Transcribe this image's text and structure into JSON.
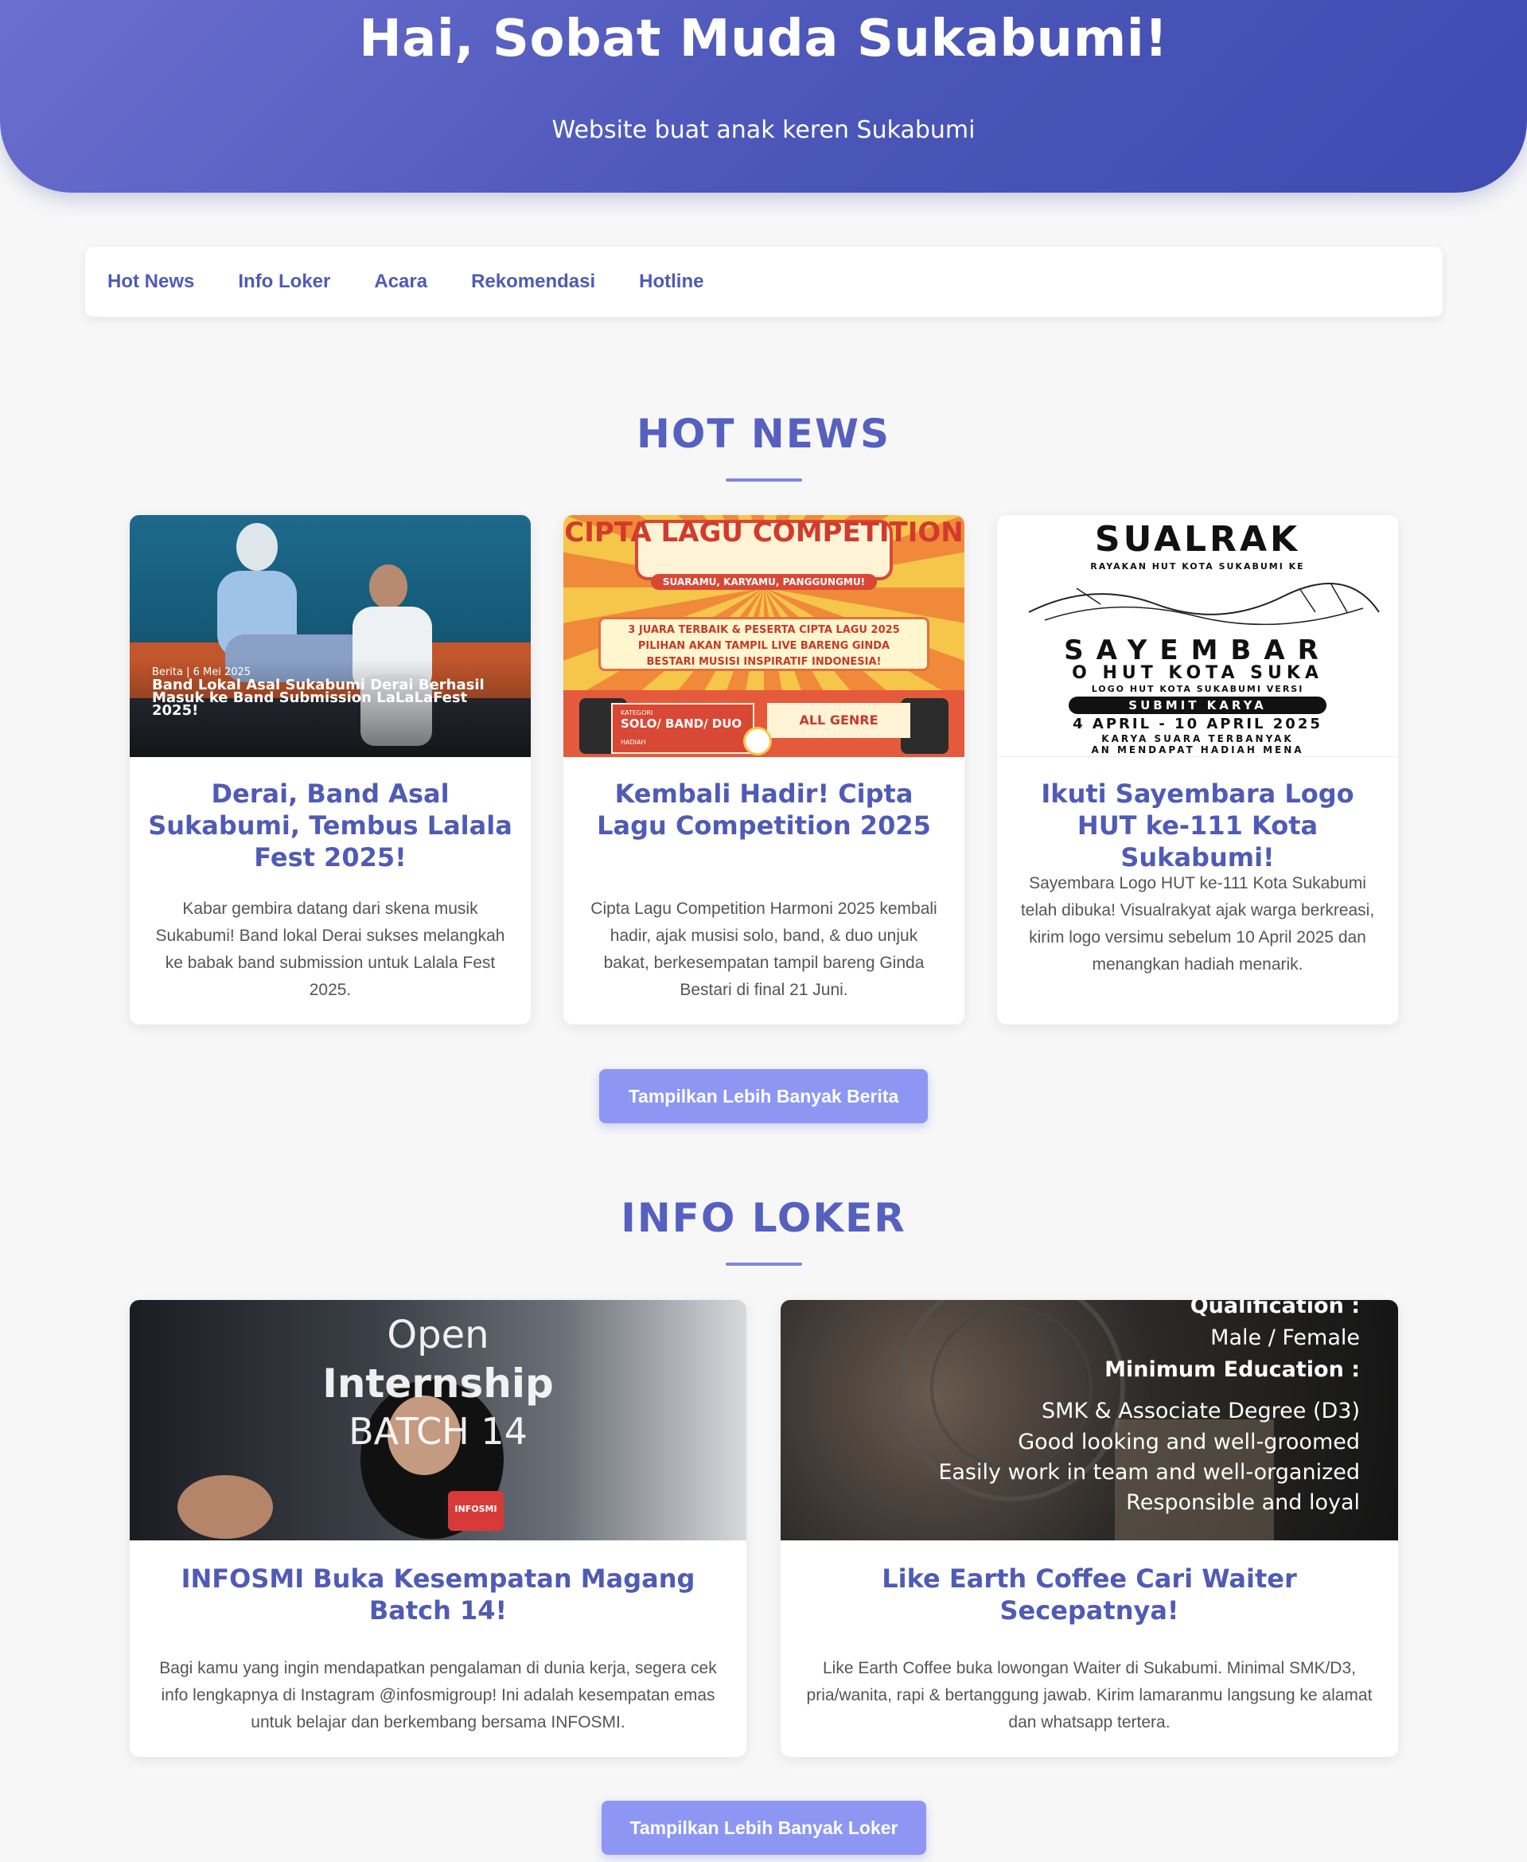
{
  "hero": {
    "title": "Hai, Sobat Muda Sukabumi!",
    "subtitle": "Website buat anak keren Sukabumi"
  },
  "nav": {
    "items": [
      {
        "label": "Hot News"
      },
      {
        "label": "Info Loker"
      },
      {
        "label": "Acara"
      },
      {
        "label": "Rekomendasi"
      },
      {
        "label": "Hotline"
      }
    ]
  },
  "hot_news": {
    "title": "HOT NEWS",
    "cards": [
      {
        "image_caption_small": "Berita | 6 Mei 2025",
        "image_caption_big": "Band Lokal Asal Sukabumi Derai Berhasil Masuk ke Band Submission LaLaLaFest 2025!",
        "title": "Derai, Band Asal Sukabumi, Tembus Lalala Fest 2025!",
        "desc": "Kabar gembira datang dari skena musik Sukabumi! Band lokal Derai sukses melangkah ke babak band submission untuk Lalala Fest 2025."
      },
      {
        "image_title": "CIPTA LAGU COMPETITION",
        "image_tagline": "SUARAMU, KARYAMU, PANGGUNGMU!",
        "image_body": "3 JUARA TERBAIK & PESERTA CIPTA LAGU 2025 PILIHAN AKAN TAMPIL LIVE BARENG GINDA BESTARI MUSISI INSPIRATIF INDONESIA!",
        "image_kategori": "KATEGORI",
        "image_solo": "SOLO/ BAND/ DUO",
        "image_genre": "ALL GENRE",
        "image_hadiah": "HADIAH",
        "title": "Kembali Hadir! Cipta Lagu Competition 2025",
        "desc": "Cipta Lagu Competition Harmoni 2025 kembali hadir, ajak musisi solo, band, & duo unjuk bakat, berkesempatan tampil bareng Ginda Bestari di final 21 Juni."
      },
      {
        "image_brand": "SUALRAK",
        "image_line1": "RAYAKAN HUT KOTA SUKABUMI KE",
        "image_line2": "SAYEMBAR",
        "image_line3": "O HUT KOTA SUKA",
        "image_line4": "LOGO HUT KOTA SUKABUMI VERSI",
        "image_submit": "SUBMIT KARYA",
        "image_dates": "4 APRIL - 10 APRIL 2025",
        "image_line5": "KARYA SUARA TERBANYAK",
        "image_line6": "AN MENDAPAT HADIAH MENA",
        "title": "Ikuti Sayembara Logo HUT ke-111 Kota Sukabumi!",
        "desc": "Sayembara Logo HUT ke-111 Kota Sukabumi telah dibuka! Visualrakyat ajak warga berkreasi, kirim logo versimu sebelum 10 April 2025 dan menangkan hadiah menarik."
      }
    ],
    "button": "Tampilkan Lebih Banyak Berita"
  },
  "info_loker": {
    "title": "INFO LOKER",
    "cards": [
      {
        "image_line1": "Open",
        "image_line2": "Internship",
        "image_line3": "BATCH 14",
        "image_mic": "INFOSMI",
        "title": "INFOSMI Buka Kesempatan Magang Batch 14!",
        "desc": "Bagi kamu yang ingin mendapatkan pengalaman di dunia kerja, segera cek info lengkapnya di Instagram @infosmigroup! Ini adalah kesempatan emas untuk belajar dan berkembang bersama INFOSMI."
      },
      {
        "image_lines": [
          "Qualification :",
          "Male / Female",
          "Minimum Education :",
          "SMK & Associate Degree (D3)",
          "Good looking and well-groomed",
          "Easily work in team and well-organized",
          "Responsible and loyal"
        ],
        "title": "Like Earth Coffee Cari Waiter Secepatnya!",
        "desc": "Like Earth Coffee buka lowongan Waiter di Sukabumi. Minimal SMK/D3, pria/wanita, rapi & bertanggung jawab. Kirim lamaranmu langsung ke alamat dan whatsapp tertera."
      }
    ],
    "button": "Tampilkan Lebih Banyak Loker"
  }
}
